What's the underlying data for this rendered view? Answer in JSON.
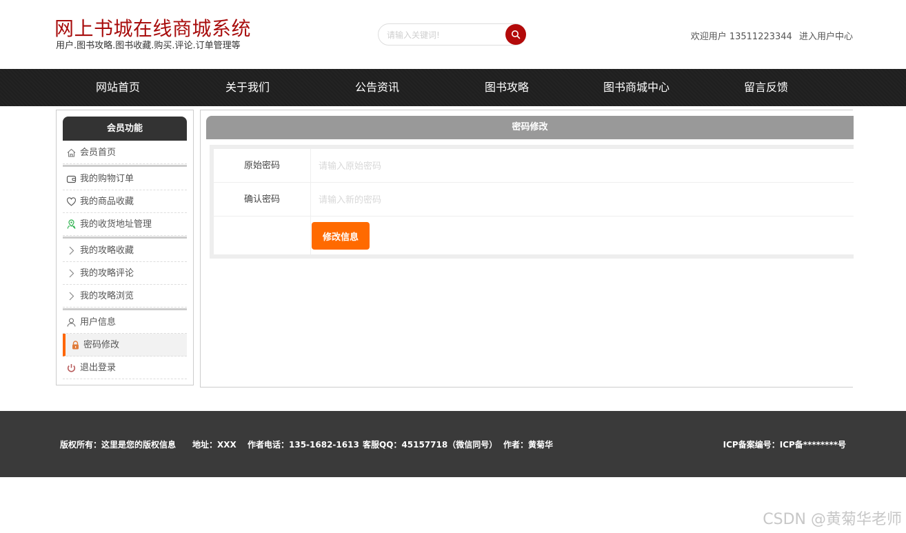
{
  "header": {
    "site_title": "网上书城在线商城系统",
    "site_subtitle": "用户.图书攻略.图书收藏.购买.评论.订单管理等",
    "search_placeholder": "请输入关键词!",
    "search_icon": "search-icon",
    "welcome_text": "欢迎用户 13511223344",
    "user_center_link": "进入用户中心"
  },
  "nav": {
    "items": [
      "网站首页",
      "关于我们",
      "公告资讯",
      "图书攻略",
      "图书商城中心",
      "留言反馈"
    ]
  },
  "sidebar": {
    "title": "会员功能",
    "items": [
      {
        "label": "会员首页",
        "icon": "home-icon"
      },
      {
        "label": "我的购物订单",
        "icon": "wallet-icon"
      },
      {
        "label": "我的商品收藏",
        "icon": "heart-icon"
      },
      {
        "label": "我的收货地址管理",
        "icon": "location-icon"
      },
      {
        "label": "我的攻略收藏",
        "icon": "chevron-right-icon"
      },
      {
        "label": "我的攻略评论",
        "icon": "chevron-right-icon"
      },
      {
        "label": "我的攻略浏览",
        "icon": "chevron-right-icon"
      },
      {
        "label": "用户信息",
        "icon": "user-icon"
      },
      {
        "label": "密码修改",
        "icon": "lock-icon",
        "active": true
      },
      {
        "label": "退出登录",
        "icon": "power-icon"
      }
    ]
  },
  "main": {
    "title": "密码修改",
    "fields": [
      {
        "label": "原始密码",
        "placeholder": "请输入原始密码",
        "value": ""
      },
      {
        "label": "确认密码",
        "placeholder": "请输入新的密码",
        "value": ""
      }
    ],
    "submit_label": "修改信息"
  },
  "footer": {
    "copyright": "版权所有：这里是您的版权信息",
    "address": "地址：XXX",
    "phone": "作者电话：135-1682-1613",
    "qq": "客服QQ：45157718（微信同号）",
    "author": "作者：黄菊华",
    "icp": "ICP备案编号：ICP备********号"
  },
  "watermark": "CSDN @黄菊华老师",
  "colors": {
    "brand_red": "#a80d0d",
    "search_button": "#b30a0a",
    "nav_bg": "#222222",
    "accent_orange": "#ff6a00",
    "footer_bg": "#3a3a3a"
  }
}
